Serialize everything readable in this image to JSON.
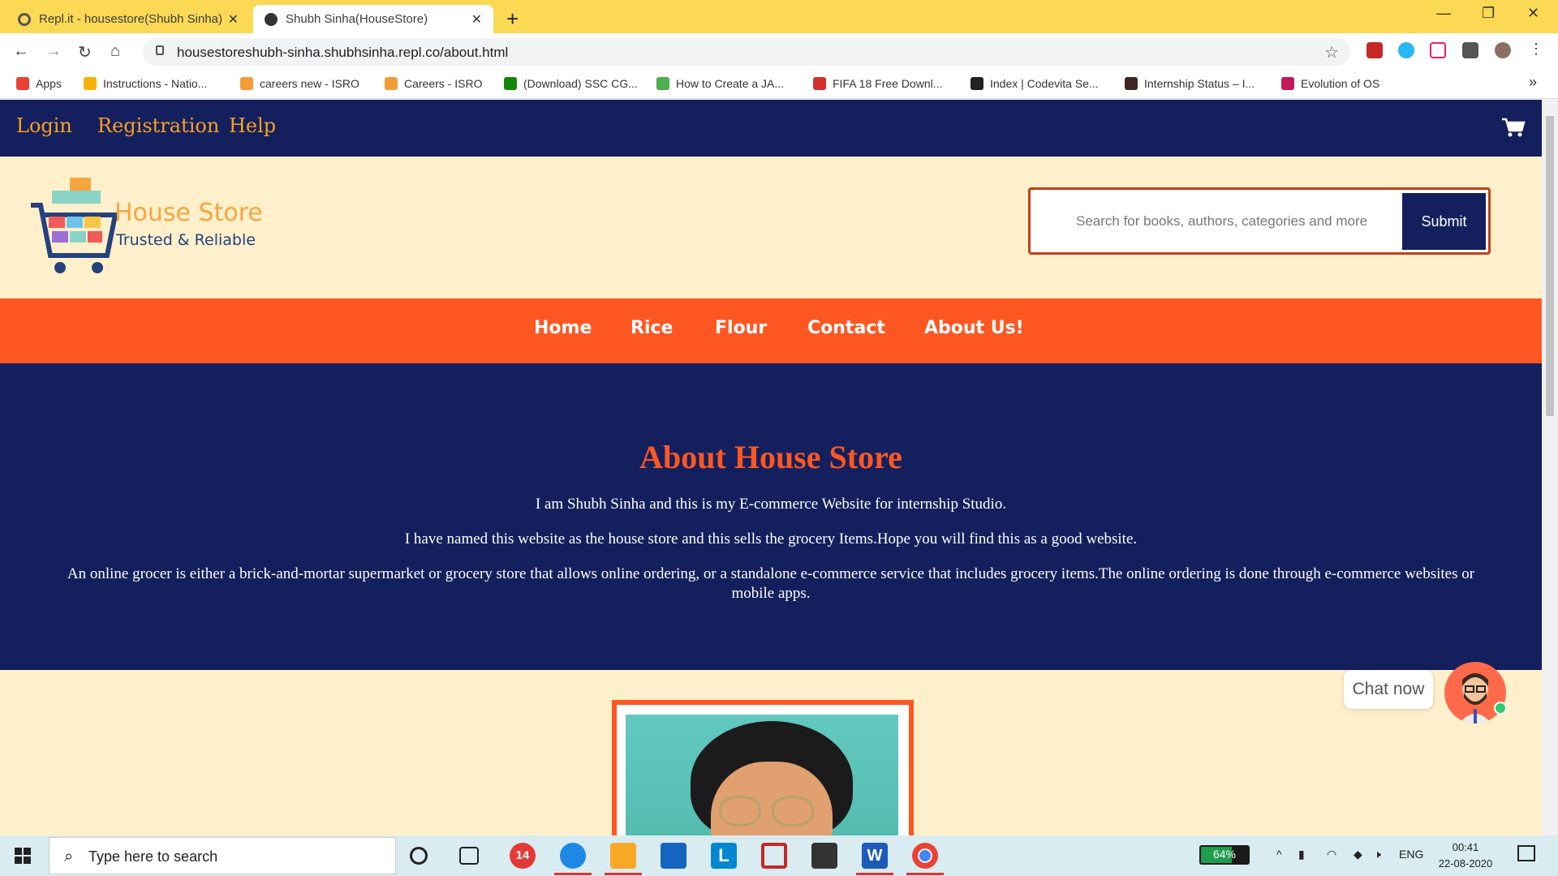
{
  "browser": {
    "tabs": [
      {
        "title": "Repl.it - housestore(Shubh Sinha)"
      },
      {
        "title": "Shubh Sinha(HouseStore)"
      }
    ],
    "url": "housestoreshubh-sinha.shubhsinha.repl.co/about.html",
    "bookmarks": [
      {
        "label": "Apps",
        "color": "#e94235"
      },
      {
        "label": "Instructions - Natio...",
        "color": "#f4b400"
      },
      {
        "label": "careers new - ISRO",
        "color": "#f29c38"
      },
      {
        "label": "Careers - ISRO",
        "color": "#f29c38"
      },
      {
        "label": "(Download) SSC CG...",
        "color": "#138808"
      },
      {
        "label": "How to Create a JA...",
        "color": "#4caf50"
      },
      {
        "label": "FIFA 18 Free Downl...",
        "color": "#d32f2f"
      },
      {
        "label": "Index | Codevita Se...",
        "color": "#222222"
      },
      {
        "label": "Internship Status – I...",
        "color": "#3e2723"
      },
      {
        "label": "Evolution of OS",
        "color": "#c2185b"
      }
    ]
  },
  "site": {
    "topnav": [
      "Login",
      "Registration",
      "Help"
    ],
    "logo": {
      "title": "House Store",
      "subtitle": "Trusted & Reliable"
    },
    "search": {
      "placeholder": "Search for books, authors, categories and more",
      "submit": "Submit"
    },
    "menu": [
      "Home",
      "Rice",
      "Flour",
      "Contact",
      "About Us!"
    ],
    "about": {
      "heading": "About House Store",
      "paragraphs": [
        "I am Shubh Sinha and this is my E-commerce Website for internship Studio.",
        "I have named this website as the house store and this sells the grocery Items.Hope you will find this as a good website.",
        "An online grocer is either a brick-and-mortar supermarket or grocery store that allows online ordering, or a standalone e-commerce service that includes grocery items.The online ordering is done through e-commerce websites or mobile apps."
      ]
    },
    "chat": {
      "label": "Chat now"
    }
  },
  "taskbar": {
    "search_placeholder": "Type here to search",
    "badge": "14",
    "battery": "64%",
    "lang": "ENG",
    "time": "00:41",
    "date": "22-08-2020"
  },
  "colors": {
    "navy": "#13205d",
    "orange": "#ff5722",
    "cream": "#fef0cb",
    "gold": "#ff9f1c"
  }
}
